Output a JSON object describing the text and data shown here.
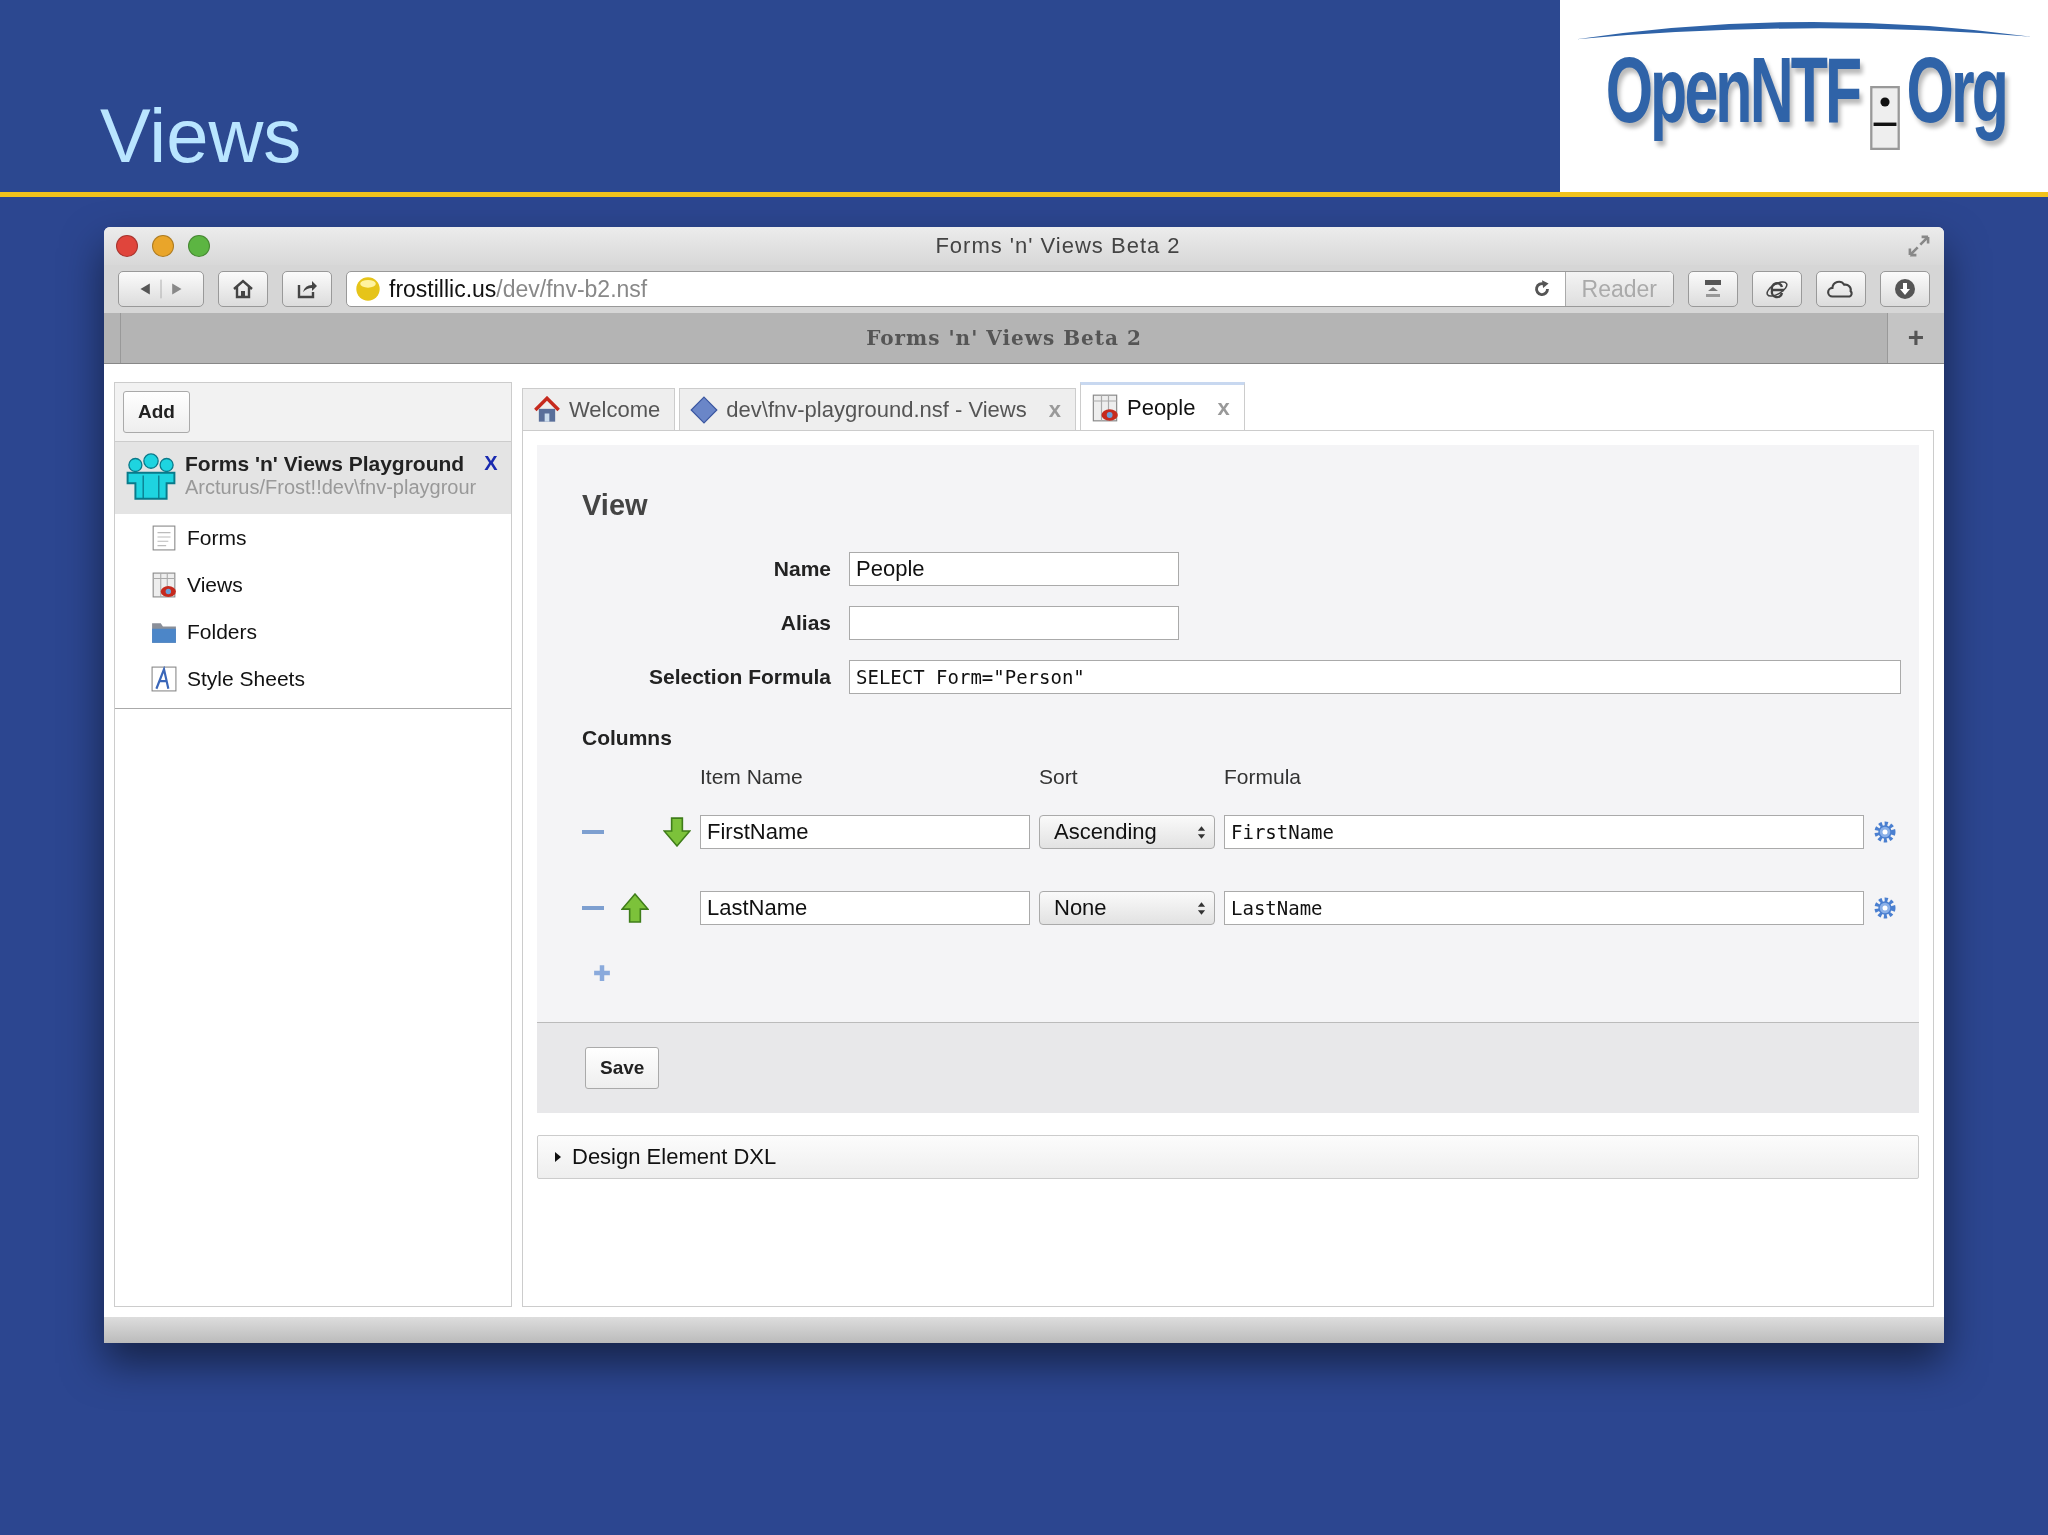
{
  "slide": {
    "title": "Views",
    "logo": {
      "left": "OpenNTF",
      "right": "Org"
    }
  },
  "browser": {
    "title": "Forms 'n' Views Beta 2",
    "url": {
      "host": "frostillic.us",
      "path": "/dev/fnv-b2.nsf"
    },
    "reader": "Reader",
    "tab_title": "Forms 'n' Views Beta 2",
    "tab_add": "+"
  },
  "sidebar": {
    "add_button": "Add",
    "database": {
      "title": "Forms 'n' Views Playground",
      "path": "Arcturus/Frost!!dev\\fnv-playgrour",
      "close": "X",
      "selected": true
    },
    "items": [
      {
        "label": "Forms",
        "kind": "form"
      },
      {
        "label": "Views",
        "kind": "view"
      },
      {
        "label": "Folders",
        "kind": "folder"
      },
      {
        "label": "Style Sheets",
        "kind": "style"
      }
    ]
  },
  "tabs": [
    {
      "label": "Welcome",
      "kind": "home",
      "selected": false
    },
    {
      "label": "dev\\fnv-playground.nsf - Views",
      "kind": "db",
      "close": "x",
      "selected": false
    },
    {
      "label": "People",
      "kind": "view",
      "close": "x",
      "selected": true
    }
  ],
  "form": {
    "heading": "View",
    "fields": [
      {
        "label": "Name",
        "value": "People",
        "kind": "short"
      },
      {
        "label": "Alias",
        "kind": "short"
      },
      {
        "label": "Selection Formula",
        "value": "SELECT Form=\"Person\"",
        "kind": "code"
      }
    ],
    "columns_heading": "Columns",
    "column_headers": [
      "Item Name",
      "Sort",
      "Formula"
    ],
    "columns": [
      {
        "item": "FirstName",
        "sort": "Ascending",
        "formula": "FirstName",
        "kind": "down"
      },
      {
        "item": "LastName",
        "sort": "None",
        "formula": "LastName",
        "kind": "up"
      }
    ],
    "save": "Save"
  },
  "dxl": {
    "label": "Design Element DXL",
    "expanded": false
  }
}
